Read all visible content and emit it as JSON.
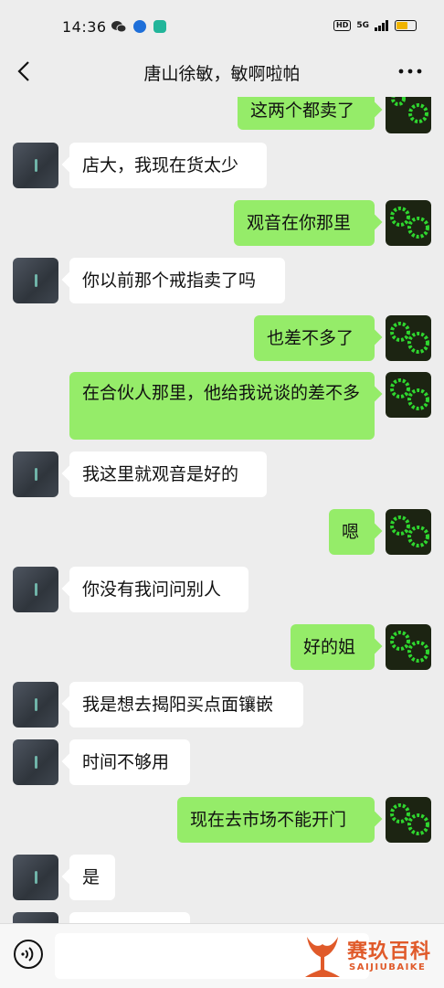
{
  "status_bar": {
    "time": "14:36",
    "hd": "HD",
    "network": "5G",
    "accent_colors": {
      "wechat": "#2c2c2c",
      "app_blue": "#1e6fd9",
      "app_teal": "#22b59a",
      "battery": "#f0b400"
    }
  },
  "header": {
    "title": "唐山徐敏，敏啊啦帕",
    "back_icon": "chevron-left-icon",
    "more_icon": "more-horizontal-icon"
  },
  "colors": {
    "background": "#ededed",
    "self_bubble": "#95ec69",
    "friend_bubble": "#ffffff"
  },
  "messages": [
    {
      "from": "self",
      "text": "这两个都卖了"
    },
    {
      "from": "friend",
      "text": "店大，我现在货太少"
    },
    {
      "from": "self",
      "text": "观音在你那里"
    },
    {
      "from": "friend",
      "text": "你以前那个戒指卖了吗"
    },
    {
      "from": "self",
      "text": "也差不多了"
    },
    {
      "from": "self",
      "text": "在合伙人那里，他给我说谈的差不多"
    },
    {
      "from": "friend",
      "text": "我这里就观音是好的"
    },
    {
      "from": "self",
      "text": "嗯"
    },
    {
      "from": "friend",
      "text": "你没有我问问别人"
    },
    {
      "from": "self",
      "text": "好的姐"
    },
    {
      "from": "friend",
      "text": "我是想去揭阳买点面镶嵌"
    },
    {
      "from": "friend",
      "text": "时间不够用"
    },
    {
      "from": "self",
      "text": "现在去市场不能开门"
    },
    {
      "from": "friend",
      "text": "是"
    }
  ],
  "input_bar": {
    "voice_icon": "voice-icon",
    "input_value": ""
  },
  "watermark": {
    "title": "赛玖百科",
    "subtitle": "SAIJIUBAIKE"
  }
}
